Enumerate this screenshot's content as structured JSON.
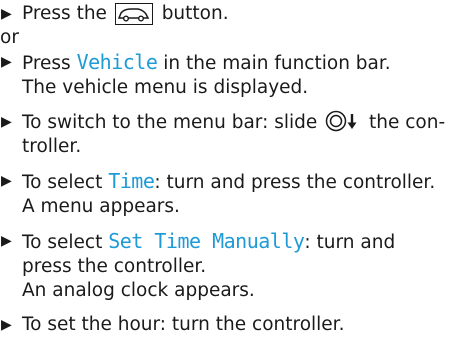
{
  "steps": [
    {
      "pre": "Press the ",
      "icon": "vehicle-button-icon",
      "post": " button."
    },
    {
      "text": "or"
    },
    {
      "pre": "Press ",
      "highlight": "Vehicle",
      "post": " in the main function bar.",
      "result": "The vehicle menu is displayed."
    },
    {
      "pre": "To switch to the menu bar: slide ",
      "icon": "controller-slide-down-icon",
      "post": " the con-",
      "line2": "troller."
    },
    {
      "pre": "To select ",
      "highlight": "Time",
      "post": ": turn and press the controller.",
      "result": "A menu appears."
    },
    {
      "pre": "To select ",
      "highlight": "Set Time Manually",
      "post": ": turn and",
      "line2": "press the controller.",
      "result": "An analog clock appears."
    },
    {
      "pre": "To set the hour: turn the controller."
    }
  ],
  "colors": {
    "highlight": "#1e9bd7",
    "text": "#1a1a1a"
  }
}
